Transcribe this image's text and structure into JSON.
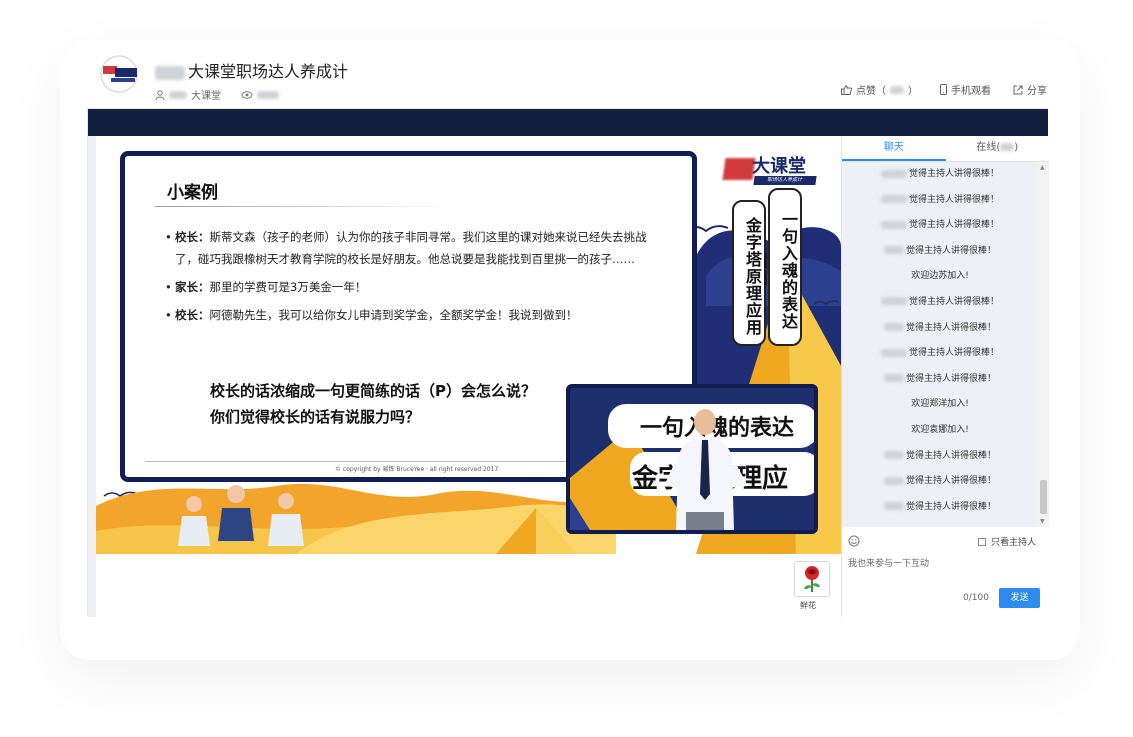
{
  "header": {
    "title": "大课堂职场达人养成计",
    "author": "大课堂",
    "actions": {
      "like": "点赞（",
      "like_close": "）",
      "mobile": "手机观看",
      "share": "分享"
    }
  },
  "slide": {
    "case_title": "小案例",
    "bullets": [
      {
        "speaker": "校长：",
        "text": "斯蒂文森（孩子的老师）认为你的孩子非同寻常。我们这里的课对她来说已经失去挑战了，碰巧我跟橡树天才教育学院的校长是好朋友。他总说要是我能找到百里挑一的孩子……"
      },
      {
        "speaker": "家长：",
        "text": "那里的学费可是3万美金一年！"
      },
      {
        "speaker": "校长：",
        "text": "阿德勒先生，我可以给你女儿申请到奖学金，全额奖学金！我说到做到！"
      }
    ],
    "question_line1": "校长的话浓缩成一句更简练的话（P）会怎么说？",
    "question_line2": "你们觉得校长的话有说服力吗？",
    "copyright": "© copyright by 易炼 BruceYee · all right reserved 2017",
    "brand": "大课堂",
    "brand_sub": "职场达人养成计",
    "vertical_left": "金字塔原理应用",
    "vertical_right": "一句入魂的表达——",
    "video_text1": "一句入魂的表达",
    "video_text2": "金字塔原理应"
  },
  "chat": {
    "tabs": {
      "chat": "聊天",
      "online": "在线(",
      "online_close": ")"
    },
    "messages": [
      "觉得主持人讲得很棒！",
      "觉得主持人讲得很棒！",
      "觉得主持人讲得很棒！",
      "觉得主持人讲得很棒！",
      "欢迎边苏加入!",
      "觉得主持人讲得很棒！",
      "觉得主持人讲得很棒！",
      "觉得主持人讲得很棒！",
      "觉得主持人讲得很棒！",
      "欢迎郑洋加入!",
      "欢迎袁娜加入!",
      "觉得主持人讲得很棒！",
      "觉得主持人讲得很棒！",
      "觉得主持人讲得很棒！"
    ],
    "only_host": "只看主持人",
    "input_placeholder": "我也来参与一下互动",
    "counter": "0/100",
    "send": "发送"
  },
  "gift": {
    "label": "鲜花"
  },
  "colors": {
    "accent": "#2d8cf0",
    "navy": "#111d55",
    "topbar": "#12203e"
  }
}
